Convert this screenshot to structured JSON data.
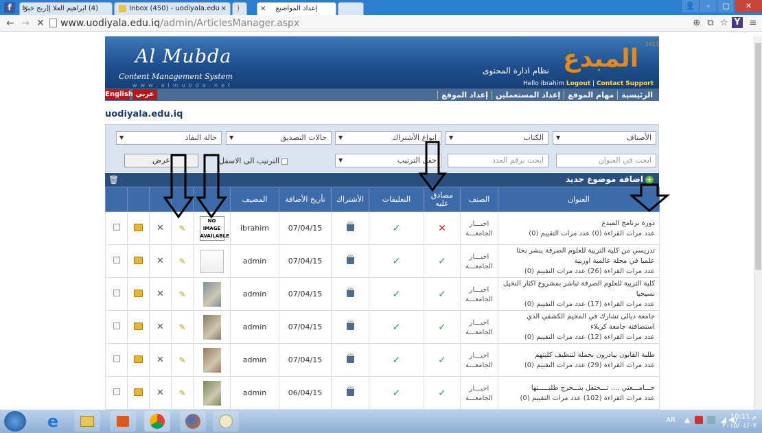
{
  "browser": {
    "tabs": [
      {
        "label": "(4) ابراهيم العلا إ[ربح خبرا"
      },
      {
        "label": "Inbox (450) - uodiyala.edu"
      },
      {
        "label": ""
      },
      {
        "label": "إعداد المواضيع"
      }
    ],
    "url_domain": "www.uodiyala.edu.iq",
    "url_path": "/admin/ArticlesManager.aspx"
  },
  "banner": {
    "title": "Al Mubda",
    "subtitle": "Content Management System",
    "web": "www.almubda.net",
    "cms_name_ar": "نظام ادارة المحتوى",
    "logo_ar": "المبدع",
    "year": "2011",
    "hello": "Hello ibrahim",
    "logout": "Logout",
    "support": "Contact Support"
  },
  "nav": {
    "english": "English",
    "arabic": "عربي",
    "menu": [
      "الرئيسية",
      "مهام الموقع",
      "إعداد المستعملين",
      "إعداد الموقع"
    ]
  },
  "site_name": "uodiyala.edu.iq",
  "filters": {
    "categories": "الأصناف",
    "writers": "الكتاب",
    "subscription_types": "انواع الأشتراك",
    "approval_states": "حالات التصديق",
    "enforcement_state": "حالة النفاذ",
    "search_title_placeholder": "ابحث في العنوان",
    "search_number_placeholder": "ابحث برقم العدد",
    "sort_field": "حقل الترتيب",
    "sort_asc": "الترتيب الى الاسفل",
    "show_button": "عرض"
  },
  "addbar": {
    "add_new": "اضافة موضوع جديد"
  },
  "table": {
    "headers": {
      "title": "العنوان",
      "category": "الصنف",
      "approved": "مصادق عليه",
      "comments": "التعليقات",
      "subscription": "الأشتراك",
      "date_added": "تأريخ الأضافة",
      "added_by": "المضيف"
    },
    "no_image_text": "NO IMAGE AVAILABLE",
    "rows": [
      {
        "title": "دورة برنامج المبدع",
        "meta": "عدد مرات القراءة (0)   عدد مرات التقييم (0)",
        "category": "اخبـــار الجامعـــة",
        "approved": false,
        "comments": true,
        "date": "07/04/15",
        "author": "ibrahim",
        "image": "none"
      },
      {
        "title": "تدريسي من كلية التربية للعلوم الصرفة ينشر بحثا علميا في مجلة عالمية اوربية",
        "meta": "عدد مرات القراءة (26)   عدد مرات التقييم (0)",
        "category": "اخبـــار الجامعـــة",
        "approved": true,
        "comments": true,
        "date": "07/04/15",
        "author": "admin",
        "image": "certificate"
      },
      {
        "title": "كلية التربية للعلوم الصرفة تباشر بمشروع اكثار النخيل نسيجيا",
        "meta": "عدد مرات القراءة (17)   عدد مرات التقييم (0)",
        "category": "اخبـــار الجامعـــة",
        "approved": true,
        "comments": true,
        "date": "07/04/15",
        "author": "admin",
        "image": "photo"
      },
      {
        "title": "جامعة ديالى تشارك في المخيم الكشفي الذي استضافته جامعة كربلاء",
        "meta": "عدد مرات القراءة (12)   عدد مرات التقييم (0)",
        "category": "اخبـــار الجامعـــة",
        "approved": true,
        "comments": true,
        "date": "07/04/15",
        "author": "admin",
        "image": "photo"
      },
      {
        "title": "طلبة القانون يبادرون بحملة لتنظيف كليتهم",
        "meta": "عدد مرات القراءة (29)   عدد مرات التقييم (0)",
        "category": "اخبـــار الجامعـــة",
        "approved": true,
        "comments": true,
        "date": "07/04/15",
        "author": "admin",
        "image": "photo"
      },
      {
        "title": "جـــامـــعتي .... تـــحتفل بتـــخرج طلبـــــتها",
        "meta": "عدد مرات القراءة (102)   عدد مرات التقييم (0)",
        "category": "اخبـــار الجامعـــة",
        "approved": true,
        "comments": true,
        "date": "06/04/15",
        "author": "admin",
        "image": "photo"
      }
    ]
  },
  "taskbar": {
    "lang": "AR",
    "time": "10:11 م",
    "date": "٢٠١٥/٠٤/٠٧"
  },
  "colors": {
    "header_blue": "#3d6aa8",
    "banner_blue": "#1f4f8e",
    "approve_green": "#3aa23a",
    "reject_red": "#d02020",
    "logo_orange": "#e08a20"
  }
}
